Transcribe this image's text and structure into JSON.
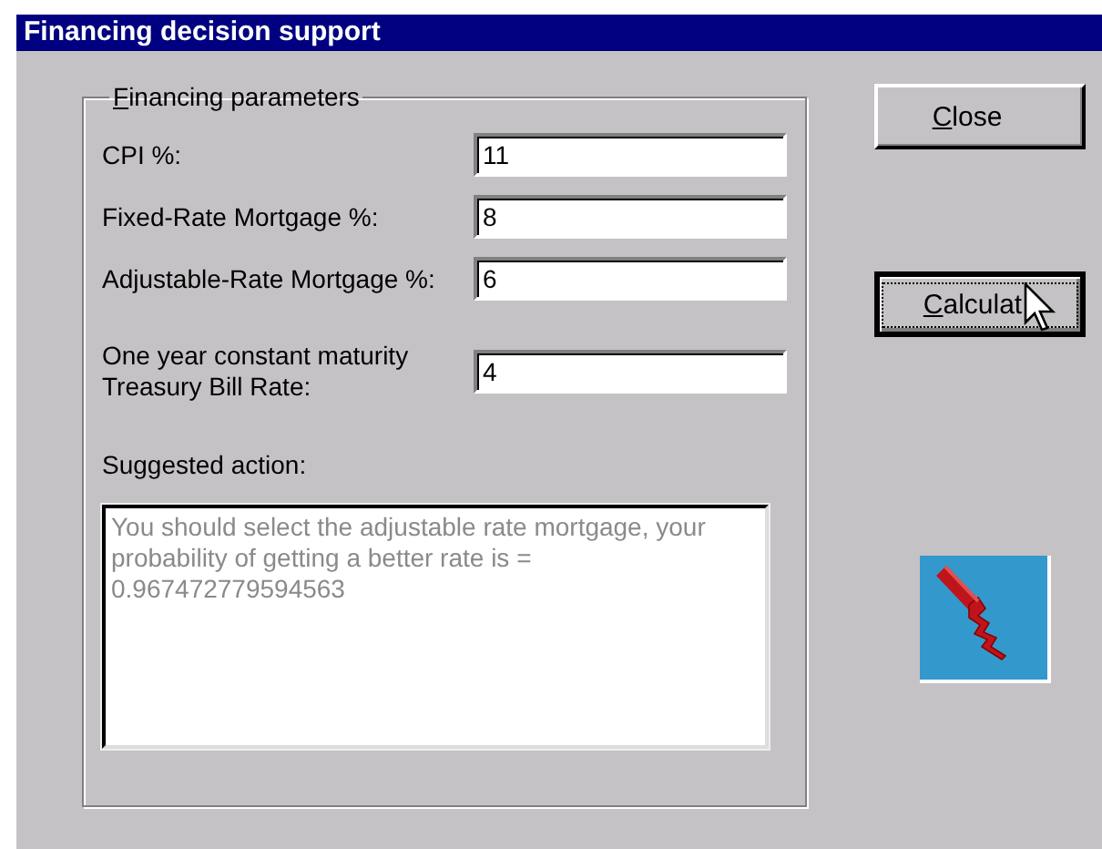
{
  "window": {
    "title": "Financing decision support"
  },
  "parameters": {
    "legend": "Financing parameters",
    "fields": [
      {
        "label": "CPI %:",
        "value": "11"
      },
      {
        "label": "Fixed-Rate Mortgage %:",
        "value": "8"
      },
      {
        "label": "Adjustable-Rate Mortgage %:",
        "value": "6"
      },
      {
        "label": "One year constant maturity Treasury Bill Rate:",
        "value": "4"
      }
    ]
  },
  "suggestion": {
    "label": "Suggested action:",
    "text": "You should select the adjustable rate mortgage, your probability of getting a better rate is = 0.967472779594563",
    "disabled": true
  },
  "buttons": [
    {
      "label": "Close",
      "focused": false
    },
    {
      "label": "Calculat",
      "focused": true
    }
  ]
}
